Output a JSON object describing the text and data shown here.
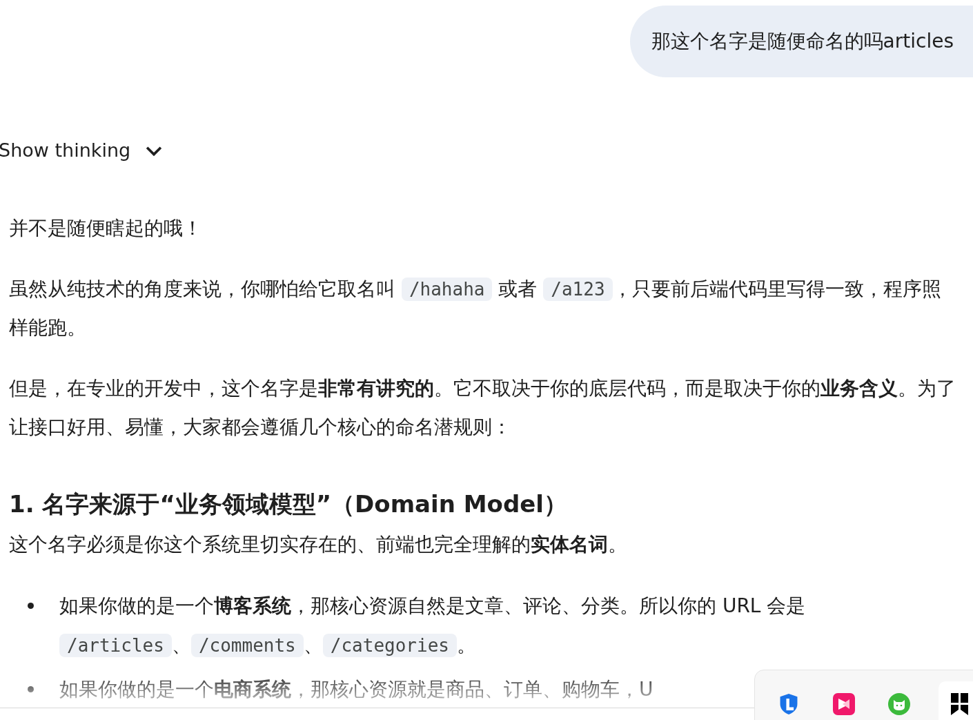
{
  "user_message": {
    "text": "那这个名字是随便命名的吗articles"
  },
  "thinking_toggle": {
    "label": "Show thinking",
    "expanded": false
  },
  "response": [
    {
      "kind": "paragraph",
      "parts": [
        {
          "kind": "text",
          "text": "并不是随便瞎起的哦！"
        }
      ]
    },
    {
      "kind": "paragraph",
      "parts": [
        {
          "kind": "text",
          "text": "虽然从纯技术的角度来说，你哪怕给它取名叫 "
        },
        {
          "kind": "code",
          "text": "/hahaha"
        },
        {
          "kind": "text",
          "text": " 或者 "
        },
        {
          "kind": "code",
          "text": "/a123"
        },
        {
          "kind": "text",
          "text": "，只要前后端代码里写得一致，程序照样能跑。"
        }
      ]
    },
    {
      "kind": "paragraph",
      "parts": [
        {
          "kind": "text",
          "text": "但是，在专业的开发中，这个名字是**非常有讲究的**。它不取决于你的底层代码，而是取决于你的**业务含义**。为了让接口好用、易懂，大家都会遵循几个核心的命名潜规则："
        }
      ]
    },
    {
      "kind": "heading",
      "parts": [
        {
          "kind": "text",
          "text": "1. 名字来源于“业务领域模型”（Domain Model）"
        }
      ]
    },
    {
      "kind": "paragraph",
      "parts": [
        {
          "kind": "text",
          "text": "这个名字必须是你这个系统里切实存在的、前端也完全理解的**实体名词**。"
        }
      ]
    },
    {
      "kind": "bullet",
      "parts": [
        {
          "kind": "text",
          "text": "如果你做的是一个**博客系统**，那核心资源自然是文章、评论、分类。所以你的 URL 会是 "
        },
        {
          "kind": "code",
          "text": "/articles"
        },
        {
          "kind": "text",
          "text": "、"
        },
        {
          "kind": "code",
          "text": "/comments"
        },
        {
          "kind": "text",
          "text": "、"
        },
        {
          "kind": "code",
          "text": "/categories"
        },
        {
          "kind": "text",
          "text": "。"
        }
      ]
    },
    {
      "kind": "bullet",
      "parts": [
        {
          "kind": "text",
          "text": "如果你做的是一个**电商系统**，那核心资源就是商品、订单、购物车，U"
        }
      ]
    }
  ]
}
